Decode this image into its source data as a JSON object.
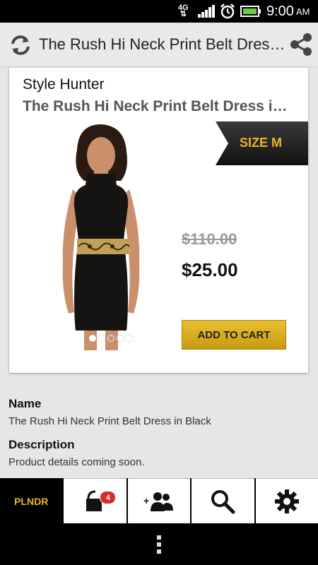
{
  "status_bar": {
    "network": "4G",
    "time": "9:00",
    "ampm": "AM"
  },
  "action_bar": {
    "title": "The Rush Hi Neck Print Belt Dress in Black",
    "icons": {
      "refresh": "refresh-icon",
      "share": "share-icon"
    }
  },
  "product": {
    "brand": "Style Hunter",
    "title": "The Rush Hi Neck Print Belt Dress in Black",
    "size": "SIZE M",
    "old_price": "$110.00",
    "price": "$25.00",
    "add_to_cart": "ADD TO CART",
    "image_count": 5,
    "active_image_index": 0
  },
  "details": {
    "name_label": "Name",
    "name_value": "The Rush Hi Neck Print Belt Dress in Black",
    "description_label": "Description",
    "description_value": "Product details coming soon."
  },
  "tabs": {
    "logo": "PLNDR",
    "cart_count": "4",
    "items": [
      "home",
      "cart",
      "friends",
      "search",
      "settings"
    ]
  },
  "colors": {
    "accent_gold": "#e9b526",
    "badge_red": "#d92b2b"
  }
}
